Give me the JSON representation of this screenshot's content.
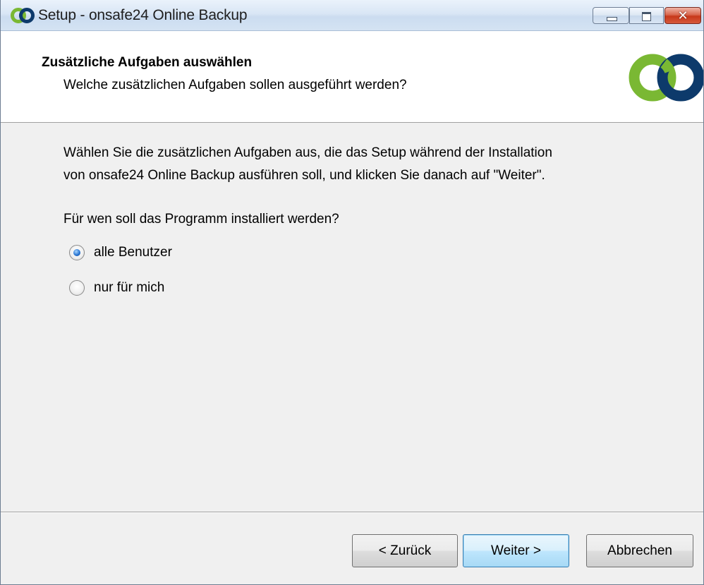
{
  "window": {
    "title": "Setup - onsafe24 Online Backup",
    "controls": {
      "minimize_icon": "minimize-icon",
      "maximize_icon": "maximize-icon",
      "close_icon": "close-icon",
      "close_glyph": "✕"
    }
  },
  "header": {
    "title": "Zusätzliche Aufgaben auswählen",
    "subtitle": "Welche zusätzlichen Aufgaben sollen ausgeführt werden?",
    "logo": "onsafe24-logo",
    "logo_colors": {
      "green": "#7ab833",
      "navy": "#0d3a6b"
    }
  },
  "body": {
    "description_line1": "Wählen Sie die zusätzlichen Aufgaben aus, die das Setup während der Installation",
    "description_line2": "von onsafe24 Online Backup ausführen soll, und klicken Sie danach auf \"Weiter\".",
    "question": "Für wen soll das Programm installiert werden?",
    "options": [
      {
        "label": "alle Benutzer",
        "checked": true
      },
      {
        "label": "nur für mich",
        "checked": false
      }
    ]
  },
  "footer": {
    "back_label": "< Zurück",
    "next_label": "Weiter >",
    "cancel_label": "Abbrechen"
  }
}
